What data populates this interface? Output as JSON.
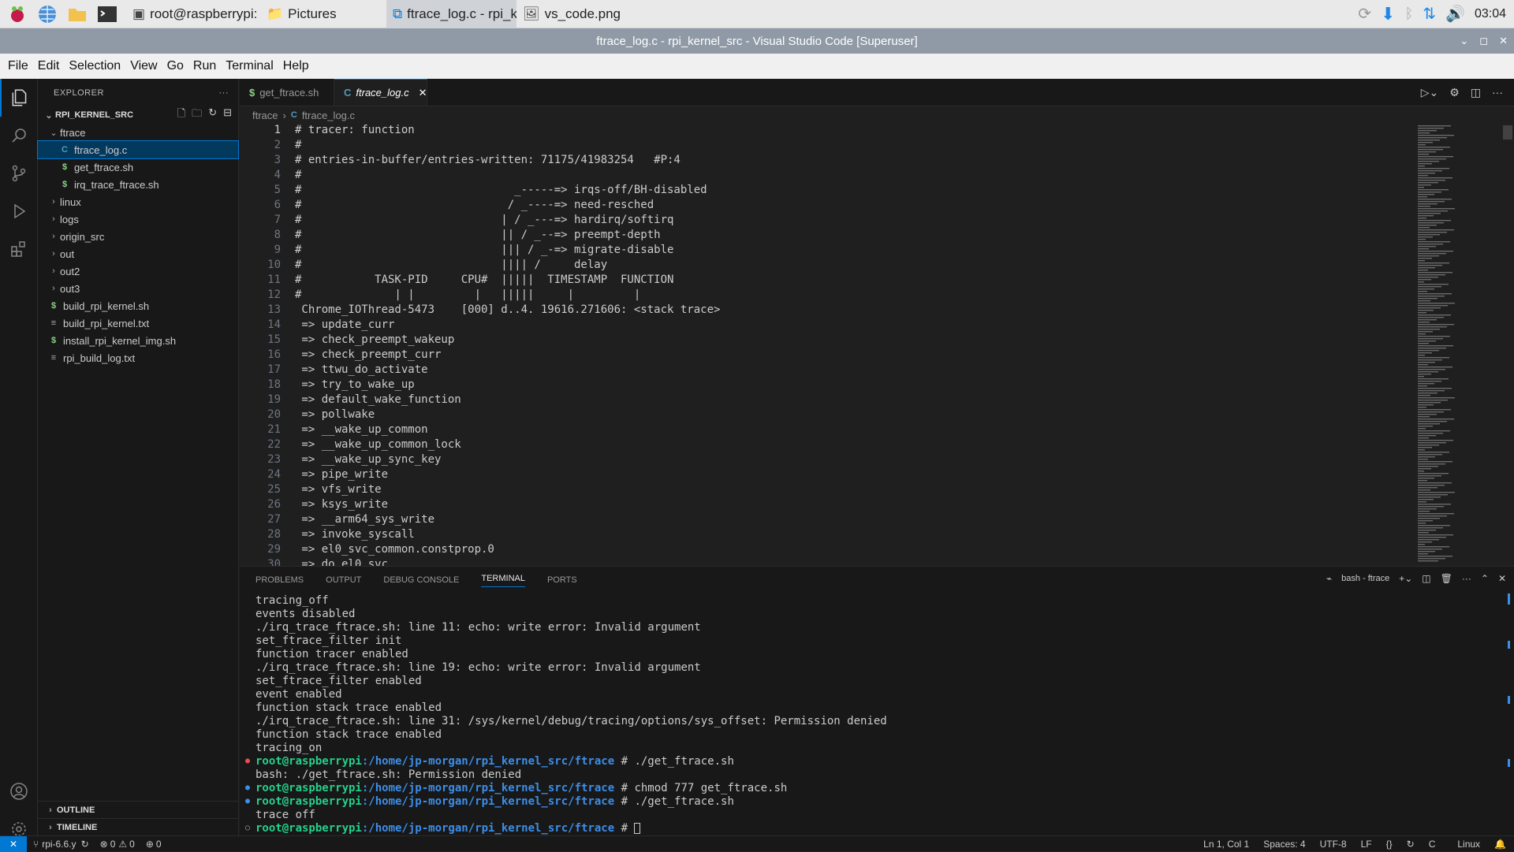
{
  "taskbar": {
    "tasks": [
      {
        "label": "root@raspberrypi: /h...",
        "icon": "terminal-icon",
        "active": false
      },
      {
        "label": "Pictures",
        "icon": "folder-icon",
        "active": false
      },
      {
        "label": "ftrace_log.c - rpi_kern...",
        "icon": "vscode-icon",
        "active": true
      },
      {
        "label": "vs_code.png",
        "icon": "image-icon",
        "active": false
      }
    ],
    "clock": "03:04"
  },
  "window": {
    "title": "ftrace_log.c - rpi_kernel_src - Visual Studio Code [Superuser]"
  },
  "menu": [
    "File",
    "Edit",
    "Selection",
    "View",
    "Go",
    "Run",
    "Terminal",
    "Help"
  ],
  "explorer": {
    "header": "EXPLORER",
    "root": "RPI_KERNEL_SRC",
    "items": [
      {
        "label": "ftrace",
        "kind": "folder-open",
        "depth": 1
      },
      {
        "label": "ftrace_log.c",
        "kind": "c",
        "depth": 2,
        "selected": true
      },
      {
        "label": "get_ftrace.sh",
        "kind": "sh",
        "depth": 2
      },
      {
        "label": "irq_trace_ftrace.sh",
        "kind": "sh",
        "depth": 2
      },
      {
        "label": "linux",
        "kind": "folder",
        "depth": 1
      },
      {
        "label": "logs",
        "kind": "folder",
        "depth": 1
      },
      {
        "label": "origin_src",
        "kind": "folder",
        "depth": 1
      },
      {
        "label": "out",
        "kind": "folder",
        "depth": 1
      },
      {
        "label": "out2",
        "kind": "folder",
        "depth": 1
      },
      {
        "label": "out3",
        "kind": "folder",
        "depth": 1
      },
      {
        "label": "build_rpi_kernel.sh",
        "kind": "sh",
        "depth": 1
      },
      {
        "label": "build_rpi_kernel.txt",
        "kind": "txt",
        "depth": 1
      },
      {
        "label": "install_rpi_kernel_img.sh",
        "kind": "sh",
        "depth": 1
      },
      {
        "label": "rpi_build_log.txt",
        "kind": "txt",
        "depth": 1
      }
    ],
    "outline": "OUTLINE",
    "timeline": "TIMELINE"
  },
  "tabs": [
    {
      "label": "get_ftrace.sh",
      "icon": "$",
      "active": false
    },
    {
      "label": "ftrace_log.c",
      "icon": "C",
      "active": true
    }
  ],
  "breadcrumb": [
    "ftrace",
    "ftrace_log.c"
  ],
  "code_lines": [
    "# tracer: function",
    "#",
    "# entries-in-buffer/entries-written: 71175/41983254   #P:4",
    "#",
    "#                                _-----=> irqs-off/BH-disabled",
    "#                               / _----=> need-resched",
    "#                              | / _---=> hardirq/softirq",
    "#                              || / _--=> preempt-depth",
    "#                              ||| / _-=> migrate-disable",
    "#                              |||| /     delay",
    "#           TASK-PID     CPU#  |||||  TIMESTAMP  FUNCTION",
    "#              | |         |   |||||     |         |",
    " Chrome_IOThread-5473    [000] d..4. 19616.271606: <stack trace>",
    " => update_curr",
    " => check_preempt_wakeup",
    " => check_preempt_curr",
    " => ttwu_do_activate",
    " => try_to_wake_up",
    " => default_wake_function",
    " => pollwake",
    " => __wake_up_common",
    " => __wake_up_common_lock",
    " => __wake_up_sync_key",
    " => pipe_write",
    " => vfs_write",
    " => ksys_write",
    " => __arm64_sys_write",
    " => invoke_syscall",
    " => el0_svc_common.constprop.0",
    " => do_el0_svc"
  ],
  "panel": {
    "tabs": [
      "PROBLEMS",
      "OUTPUT",
      "DEBUG CONSOLE",
      "TERMINAL",
      "PORTS"
    ],
    "terminal_name": "bash - ftrace",
    "lines": [
      {
        "text": "tracing_off"
      },
      {
        "text": "events disabled"
      },
      {
        "text": "./irq_trace_ftrace.sh: line 11: echo: write error: Invalid argument"
      },
      {
        "text": "set_ftrace_filter init"
      },
      {
        "text": "function tracer enabled"
      },
      {
        "text": "./irq_trace_ftrace.sh: line 19: echo: write error: Invalid argument"
      },
      {
        "text": "set_ftrace_filter enabled"
      },
      {
        "text": "event enabled"
      },
      {
        "text": "function stack trace enabled"
      },
      {
        "text": "./irq_trace_ftrace.sh: line 31: /sys/kernel/debug/tracing/options/sys_offset: Permission denied"
      },
      {
        "text": "function stack trace enabled"
      },
      {
        "text": "tracing_on"
      },
      {
        "user": "root@raspberrypi",
        "path": ":/home/jp-morgan/rpi_kernel_src/ftrace",
        "cmd": " # ./get_ftrace.sh",
        "dot": "red"
      },
      {
        "text": "bash: ./get_ftrace.sh: Permission denied"
      },
      {
        "user": "root@raspberrypi",
        "path": ":/home/jp-morgan/rpi_kernel_src/ftrace",
        "cmd": " # chmod 777 get_ftrace.sh",
        "dot": "blue"
      },
      {
        "user": "root@raspberrypi",
        "path": ":/home/jp-morgan/rpi_kernel_src/ftrace",
        "cmd": " # ./get_ftrace.sh",
        "dot": "blue"
      },
      {
        "text": "trace off"
      },
      {
        "user": "root@raspberrypi",
        "path": ":/home/jp-morgan/rpi_kernel_src/ftrace",
        "cmd": " # ",
        "dot": "gray",
        "cursor": true
      }
    ]
  },
  "status": {
    "branch": "rpi-6.6.y",
    "errors": "0",
    "warnings": "0",
    "ports": "0",
    "position": "Ln 1, Col 1",
    "spaces": "Spaces: 4",
    "encoding": "UTF-8",
    "eol": "LF",
    "language": "C",
    "platform": "Linux"
  },
  "colors": {
    "accent": "#0078d4",
    "sh_icon": "#89d185",
    "c_icon": "#519aba",
    "prompt_user": "#23d18b",
    "prompt_path": "#3b8eea"
  }
}
